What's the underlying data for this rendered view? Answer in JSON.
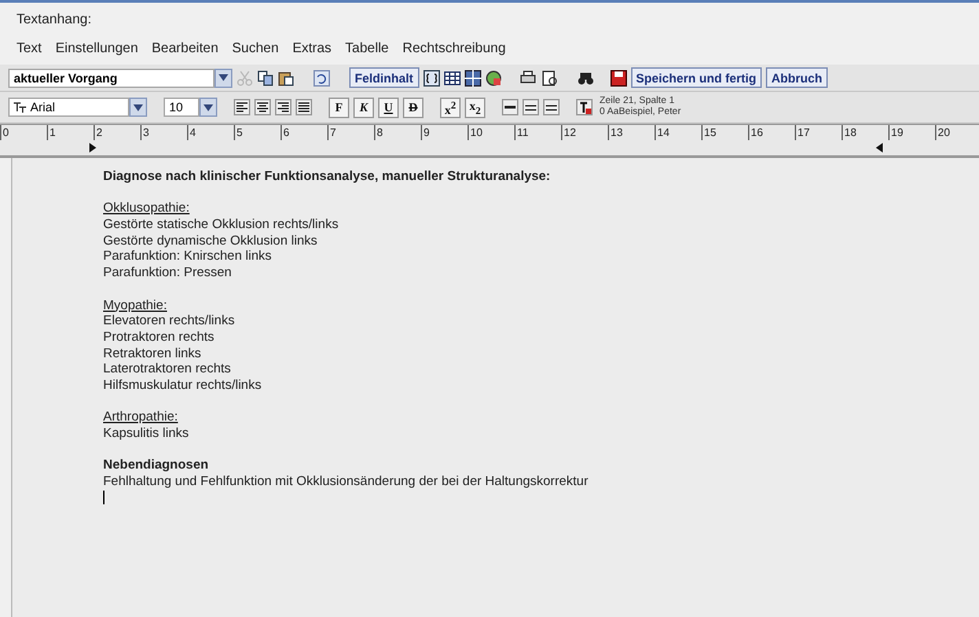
{
  "window": {
    "title": "Textanhang:"
  },
  "menu": [
    "Text",
    "Einstellungen",
    "Bearbeiten",
    "Suchen",
    "Extras",
    "Tabelle",
    "Rechtschreibung"
  ],
  "toolbar": {
    "vorgang": "aktueller Vorgang",
    "cut_disabled": true,
    "field_button": "Feldinhalt",
    "save_button": "Speichern und fertig",
    "cancel_button": "Abbruch"
  },
  "format_bar": {
    "font": "Arial",
    "size": "10",
    "bold": "F",
    "italic": "K",
    "underline": "U",
    "strike": "D",
    "superscript": "x$^{2}$",
    "subscript": "x$_{2}$",
    "status_line_1": "Zeile 21, Spalte 1",
    "status_line_2": "0 AaBeispiel, Peter"
  },
  "ruler": [
    "0",
    "1",
    "2",
    "3",
    "4",
    "5",
    "6",
    "7",
    "8",
    "9",
    "10",
    "11",
    "12",
    "13",
    "14",
    "15",
    "16",
    "17",
    "18",
    "19",
    "20"
  ],
  "document": [
    {
      "kind": "bold",
      "text": "Diagnose nach klinischer Funktionsanalyse, manueller Strukturanalyse:"
    },
    {
      "kind": "blank"
    },
    {
      "kind": "underline",
      "text": "Okklusopathie:"
    },
    {
      "kind": "normal",
      "text": "Gestörte statische Okklusion rechts/links"
    },
    {
      "kind": "normal",
      "text": "Gestörte dynamische Okklusion links"
    },
    {
      "kind": "normal",
      "text": "Parafunktion: Knirschen links"
    },
    {
      "kind": "normal",
      "text": "Parafunktion: Pressen"
    },
    {
      "kind": "blank"
    },
    {
      "kind": "underline",
      "text": "Myopathie:"
    },
    {
      "kind": "normal",
      "text": "Elevatoren rechts/links"
    },
    {
      "kind": "normal",
      "text": "Protraktoren rechts"
    },
    {
      "kind": "normal",
      "text": "Retraktoren links"
    },
    {
      "kind": "normal",
      "text": "Laterotraktoren rechts"
    },
    {
      "kind": "normal",
      "text": "Hilfsmuskulatur rechts/links"
    },
    {
      "kind": "blank"
    },
    {
      "kind": "underline",
      "text": "Arthropathie:"
    },
    {
      "kind": "normal",
      "text": "Kapsulitis links"
    },
    {
      "kind": "blank"
    },
    {
      "kind": "bold",
      "text": "Nebendiagnosen"
    },
    {
      "kind": "normal",
      "text": "Fehlhaltung und Fehlfunktion mit Okklusionsänderung der bei der Haltungskorrektur"
    },
    {
      "kind": "cursor"
    }
  ]
}
